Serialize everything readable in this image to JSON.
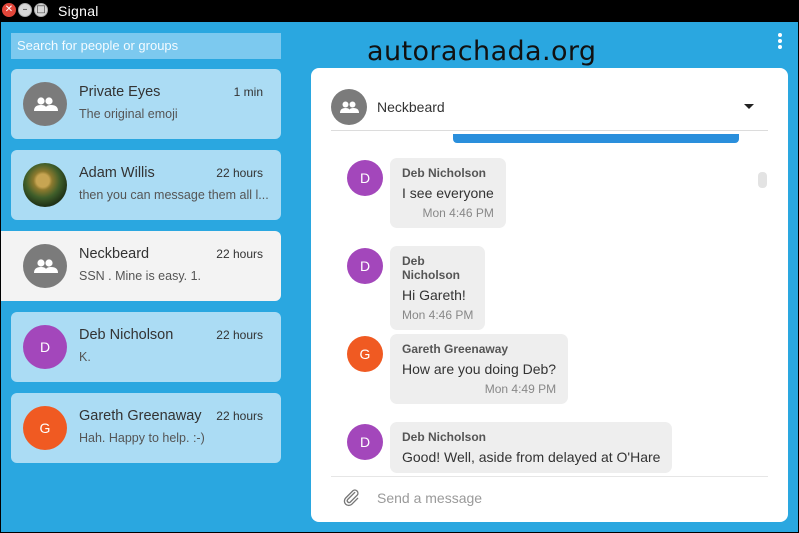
{
  "window": {
    "title": "Signal"
  },
  "watermark": "autorachada.org",
  "search": {
    "placeholder": "Search for people or groups"
  },
  "conversations": [
    {
      "name": "Private Eyes",
      "time": "1 min",
      "preview": "The original emoji",
      "avatar_icon": "group-icon",
      "avatar_color": "#7b7b7b"
    },
    {
      "name": "Adam Willis",
      "time": "22 hours",
      "preview": "then you can message them all l...",
      "avatar_icon": "photo"
    },
    {
      "name": "Neckbeard",
      "time": "22 hours",
      "preview": "SSN . Mine is easy. 1.",
      "avatar_icon": "group-icon",
      "avatar_color": "#7b7b7b",
      "active": true
    },
    {
      "name": "Deb Nicholson",
      "time": "22 hours",
      "preview": "K.",
      "initial": "D",
      "avatar_color": "#a347bb"
    },
    {
      "name": "Gareth Greenaway",
      "time": "22 hours",
      "preview": "Hah. Happy to help. :-)",
      "initial": "G",
      "avatar_color": "#f05a22"
    }
  ],
  "active_conversation": {
    "name": "Neckbeard",
    "avatar_icon": "group-icon"
  },
  "messages": [
    {
      "initial": "D",
      "sender": "Deb Nicholson",
      "text": "I see everyone",
      "time": "Mon 4:46 PM",
      "avatar_color": "#a347bb"
    },
    {
      "initial": "D",
      "sender": "Deb Nicholson",
      "text": "Hi Gareth!",
      "time": "Mon 4:46 PM",
      "avatar_color": "#a347bb"
    },
    {
      "initial": "G",
      "sender": "Gareth Greenaway",
      "text": "How are you doing Deb?",
      "time": "Mon 4:49 PM",
      "avatar_color": "#f05a22"
    },
    {
      "initial": "D",
      "sender": "Deb Nicholson",
      "text": "Good! Well, aside from delayed at O'Hare",
      "time": "",
      "avatar_color": "#a347bb"
    }
  ],
  "compose": {
    "placeholder": "Send a message"
  },
  "colors": {
    "app_background": "#2aa7e0",
    "sidebar_item": "#abdcf4",
    "active_item": "#f3f3f3",
    "accent_bar": "#2a8fdc"
  }
}
